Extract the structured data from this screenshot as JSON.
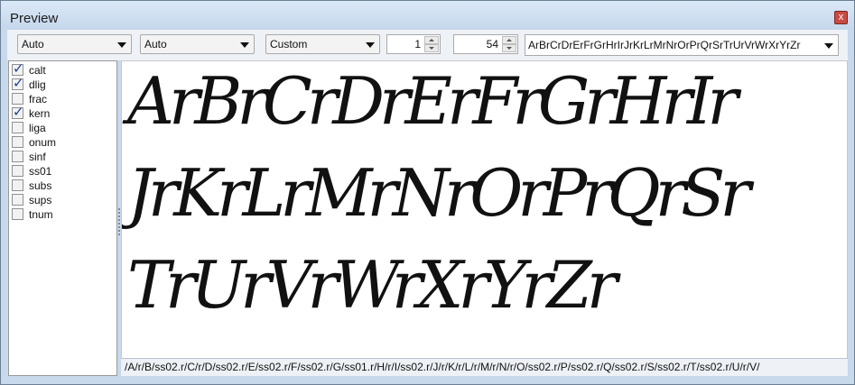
{
  "window": {
    "title": "Preview",
    "close_label": "x"
  },
  "toolbar": {
    "combo1": "Auto",
    "combo2": "Auto",
    "combo3": "Custom",
    "spin1_value": "1",
    "spin2_value": "54",
    "preview_text": "ArBrCrDrErFrGrHrIrJrKrLrMrNrOrPrQrSrTrUrVrWrXrYrZr"
  },
  "features": [
    {
      "label": "calt",
      "checked": true
    },
    {
      "label": "dlig",
      "checked": true
    },
    {
      "label": "frac",
      "checked": false
    },
    {
      "label": "kern",
      "checked": true
    },
    {
      "label": "liga",
      "checked": false
    },
    {
      "label": "onum",
      "checked": false
    },
    {
      "label": "sinf",
      "checked": false
    },
    {
      "label": "ss01",
      "checked": false
    },
    {
      "label": "subs",
      "checked": false
    },
    {
      "label": "sups",
      "checked": false
    },
    {
      "label": "tnum",
      "checked": false
    }
  ],
  "preview": {
    "lines": [
      "ArBrCrDrErFrGrHrIr",
      "JrKrLrMrNrOrPrQrSr",
      "TrUrVrWrXrYrZr"
    ]
  },
  "status": "/A/r/B/ss02.r/C/r/D/ss02.r/E/ss02.r/F/ss02.r/G/ss01.r/H/r/I/ss02.r/J/r/K/r/L/r/M/r/N/r/O/ss02.r/P/ss02.r/Q/ss02.r/S/ss02.r/T/ss02.r/U/r/V/"
}
